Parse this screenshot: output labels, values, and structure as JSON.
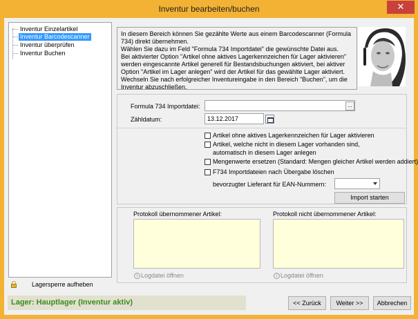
{
  "window": {
    "title": "Inventur bearbeiten/buchen",
    "close_glyph": "✕"
  },
  "tree": {
    "items": [
      {
        "label": "Inventur Einzelartikel",
        "selected": false
      },
      {
        "label": "Inventur Barcodescanner",
        "selected": true
      },
      {
        "label": "Inventur überprüfen",
        "selected": false
      },
      {
        "label": "Inventur Buchen",
        "selected": false
      }
    ]
  },
  "lock": {
    "label": "Lagersperre aufheben",
    "icon": "lock-icon"
  },
  "info": {
    "text": "In diesem Bereich können Sie gezählte Werte aus einem Barcodescanner (Formula 734) direkt übernehmen.\nWählen Sie dazu im Feld \"Formula 734 Importdatei\" die gewünschte Datei aus.\nBei aktivierter Option \"Artikel ohne aktives Lagerkennzeichen für Lager aktivieren\" werden eingescannte Artikel generell für Bestandsbuchungen aktiviert, bei aktiver Option \"Artikel im Lager anlegen\" wird der Artikel für das gewählte Lager aktiviert.\nWechseln Sie nach erfolgreicher Inventureingabe in den Bereich \"Buchen\", um die Inventur abzuschließen."
  },
  "form": {
    "import_file_label": "Formula 734 Importdatei:",
    "import_file_value": "",
    "browse_label": "...",
    "date_label": "Zähldatum:",
    "date_value": "13.12.2017",
    "checkboxes": [
      {
        "label": "Artikel ohne aktives Lagerkennzeichen für Lager aktivieren",
        "checked": false
      },
      {
        "label": "Artikel, welche nicht in diesem Lager vorhanden sind,",
        "label2": "automatisch in diesem Lager anlegen",
        "checked": false
      },
      {
        "label": "Mengenwerte ersetzen (Standard: Mengen gleicher Artikel werden addiert)",
        "checked": false
      },
      {
        "label": "F734 Importdateien nach Übergabe löschen",
        "checked": false
      }
    ],
    "supplier_label": "bevorzugter Lieferant für EAN-Nummern:",
    "supplier_value": "",
    "import_button": "Import starten"
  },
  "protocol": {
    "imported_label": "Protokoll übernommener Artikel:",
    "not_imported_label": "Protokoll nicht übernommener Artikel:",
    "logfile_link": "Logdatei öffnen",
    "info_glyph": "i"
  },
  "footer": {
    "status": "Lager: Hauptlager (Inventur aktiv)",
    "back_button": "<< Zurück",
    "next_button": "Weiter >>",
    "cancel_button": "Abbrechen"
  },
  "colors": {
    "titlebar": "#f3b233",
    "selection": "#3399ff",
    "status_text": "#3a8c1e",
    "protocol_bg": "#ffffdc",
    "close_button": "#c8413b"
  }
}
